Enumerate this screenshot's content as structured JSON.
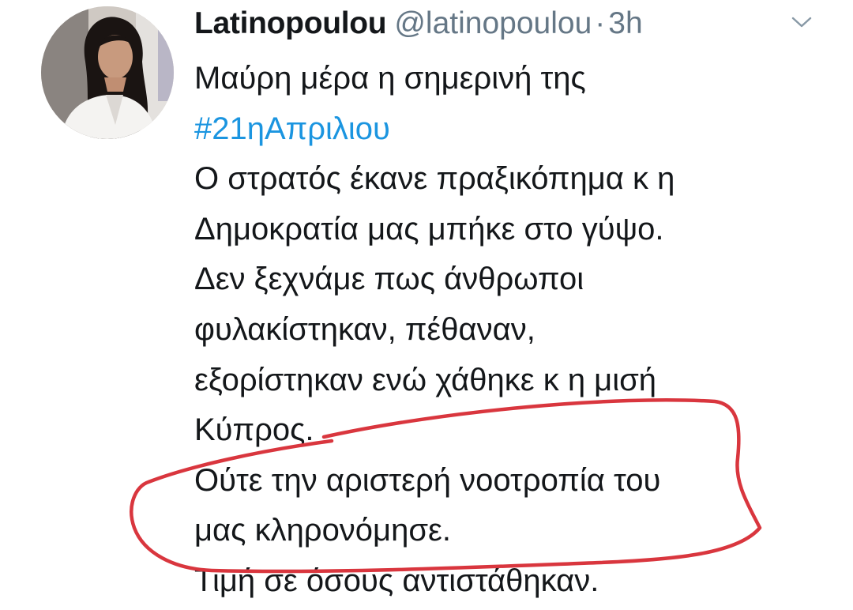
{
  "tweet": {
    "author": {
      "display_name": "Latinopoulou",
      "handle": "@latinopoulou",
      "separator": "·",
      "time": "3h"
    },
    "text_lines": [
      "Μαύρη μέρα η σημερινή της",
      "#21ηΑπριλιου",
      "Ο στρατός έκανε πραξικόπημα κ η",
      "Δημοκρατία μας μπήκε στο γύψο.",
      "Δεν ξεχνάμε πως άνθρωποι",
      "φυλακίστηκαν, πέθαναν,",
      "εξορίστηκαν ενώ χάθηκε κ η μισή",
      "Κύπρος.",
      "Ούτε την αριστερή νοοτροπία του",
      "μας κληρονόμησε.",
      "Τιμή σε όσους αντιστάθηκαν."
    ],
    "icons": {
      "menu": "chevron-down-icon",
      "avatar": "profile-photo"
    }
  },
  "annotation": {
    "color": "#d9363e",
    "kind": "hand-drawn circle"
  }
}
